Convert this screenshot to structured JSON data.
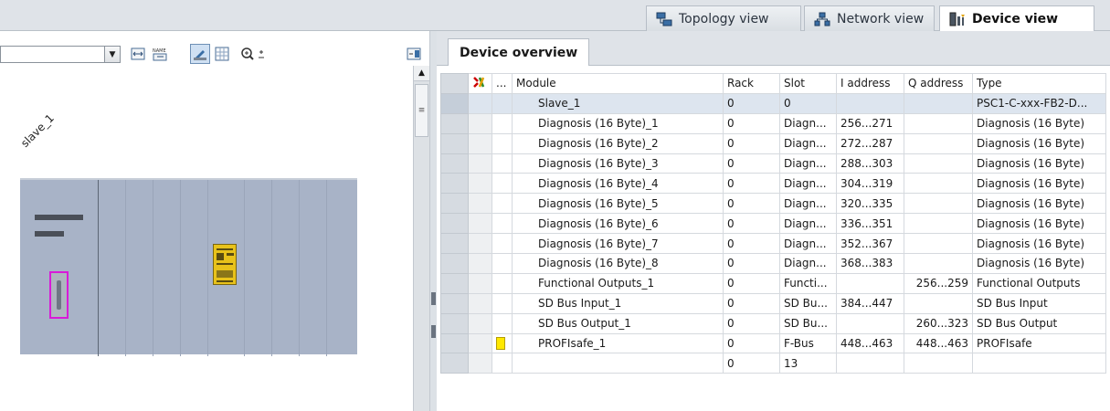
{
  "view_tabs": [
    {
      "label": "Topology view",
      "icon": "topology-icon",
      "active": false
    },
    {
      "label": "Network view",
      "icon": "network-icon",
      "active": false
    },
    {
      "label": "Device view",
      "icon": "device-icon",
      "active": true
    }
  ],
  "graphic": {
    "device_label": "slave_1",
    "toolbar_icons": [
      "combo-dropdown",
      "fit-module-icon",
      "name-icon",
      "draw-icon",
      "grid-icon",
      "zoom-in-icon",
      "collapse-panel-icon"
    ]
  },
  "overview": {
    "tab_label": "Device overview",
    "columns": {
      "ellipsis": "...",
      "module": "Module",
      "rack": "Rack",
      "slot": "Slot",
      "i_address": "I address",
      "q_address": "Q address",
      "type": "Type"
    },
    "rows": [
      {
        "module": "Slave_1",
        "rack": "0",
        "slot": "0",
        "i_address": "",
        "q_address": "",
        "type": "PSC1-C-xxx-FB2-D...",
        "indicator": false
      },
      {
        "module": "Diagnosis (16 Byte)_1",
        "rack": "0",
        "slot": "Diagn...",
        "i_address": "256...271",
        "q_address": "",
        "type": "Diagnosis (16 Byte)",
        "indicator": false
      },
      {
        "module": "Diagnosis (16 Byte)_2",
        "rack": "0",
        "slot": "Diagn...",
        "i_address": "272...287",
        "q_address": "",
        "type": "Diagnosis (16 Byte)",
        "indicator": false
      },
      {
        "module": "Diagnosis (16 Byte)_3",
        "rack": "0",
        "slot": "Diagn...",
        "i_address": "288...303",
        "q_address": "",
        "type": "Diagnosis (16 Byte)",
        "indicator": false
      },
      {
        "module": "Diagnosis (16 Byte)_4",
        "rack": "0",
        "slot": "Diagn...",
        "i_address": "304...319",
        "q_address": "",
        "type": "Diagnosis (16 Byte)",
        "indicator": false
      },
      {
        "module": "Diagnosis (16 Byte)_5",
        "rack": "0",
        "slot": "Diagn...",
        "i_address": "320...335",
        "q_address": "",
        "type": "Diagnosis (16 Byte)",
        "indicator": false
      },
      {
        "module": "Diagnosis (16 Byte)_6",
        "rack": "0",
        "slot": "Diagn...",
        "i_address": "336...351",
        "q_address": "",
        "type": "Diagnosis (16 Byte)",
        "indicator": false
      },
      {
        "module": "Diagnosis (16 Byte)_7",
        "rack": "0",
        "slot": "Diagn...",
        "i_address": "352...367",
        "q_address": "",
        "type": "Diagnosis (16 Byte)",
        "indicator": false
      },
      {
        "module": "Diagnosis (16 Byte)_8",
        "rack": "0",
        "slot": "Diagn...",
        "i_address": "368...383",
        "q_address": "",
        "type": "Diagnosis (16 Byte)",
        "indicator": false
      },
      {
        "module": "Functional Outputs_1",
        "rack": "0",
        "slot": "Functi...",
        "i_address": "",
        "q_address": "256...259",
        "type": "Functional Outputs",
        "indicator": false
      },
      {
        "module": "SD Bus Input_1",
        "rack": "0",
        "slot": "SD Bu...",
        "i_address": "384...447",
        "q_address": "",
        "type": "SD Bus Input",
        "indicator": false
      },
      {
        "module": "SD Bus Output_1",
        "rack": "0",
        "slot": "SD Bu...",
        "i_address": "",
        "q_address": "260...323",
        "type": "SD Bus Output",
        "indicator": false
      },
      {
        "module": "PROFIsafe_1",
        "rack": "0",
        "slot": "F-Bus",
        "i_address": "448...463",
        "q_address": "448...463",
        "type": "PROFIsafe",
        "indicator": true
      },
      {
        "module": "",
        "rack": "0",
        "slot": "13",
        "i_address": "",
        "q_address": "",
        "type": "",
        "indicator": false
      }
    ]
  },
  "colors": {
    "rack": "#a8b3c7",
    "selected_port": "#d81ad8",
    "module": "#e8c21a",
    "indicator": "#ffe800",
    "header_bg": "#dfe3e8"
  }
}
